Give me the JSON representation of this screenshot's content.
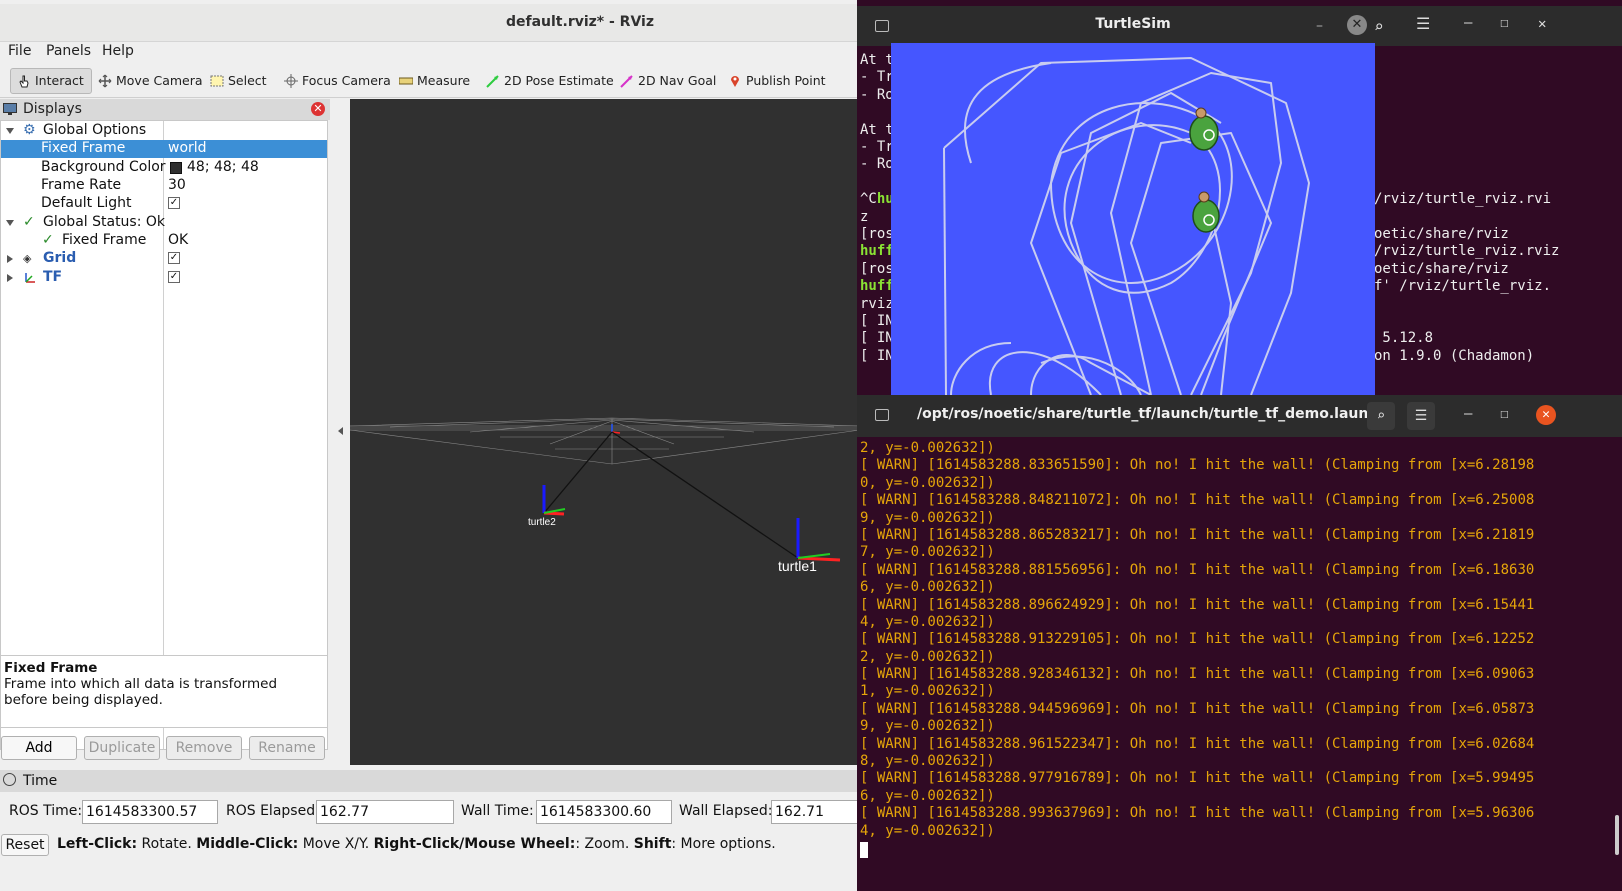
{
  "rviz": {
    "title": "default.rviz* - RViz",
    "menu": [
      "File",
      "Panels",
      "Help"
    ],
    "toolbar": [
      "Interact",
      "Move Camera",
      "Select",
      "Focus Camera",
      "Measure",
      "2D Pose Estimate",
      "2D Nav Goal",
      "Publish Point"
    ],
    "displays": {
      "header": "Displays",
      "global_options": "Global Options",
      "fixed_frame_label": "Fixed Frame",
      "fixed_frame_value": "world",
      "background_color_label": "Background Color",
      "background_color_value": "48; 48; 48",
      "background_color_swatch": "#303030",
      "frame_rate_label": "Frame Rate",
      "frame_rate_value": "30",
      "default_light_label": "Default Light",
      "global_status": "Global Status: Ok",
      "status_fixed_frame_label": "Fixed Frame",
      "status_fixed_frame_value": "OK",
      "grid": "Grid",
      "tf": "TF"
    },
    "description": {
      "title": "Fixed Frame",
      "text": "Frame into which all data is transformed before being displayed."
    },
    "buttons": {
      "add": "Add",
      "duplicate": "Duplicate",
      "remove": "Remove",
      "rename": "Rename"
    },
    "view": {
      "turtle2_label": "turtle2",
      "turtle1_label": "turtle1"
    },
    "time": {
      "header": "Time",
      "ros_time_label": "ROS Time:",
      "ros_time": "1614583300.57",
      "ros_elapsed_label": "ROS Elapsed:",
      "ros_elapsed": "162.77",
      "wall_time_label": "Wall Time:",
      "wall_time": "1614583300.60",
      "wall_elapsed_label": "Wall Elapsed:",
      "wall_elapsed": "162.71",
      "reset": "Reset",
      "hint_left": "Left-Click:",
      "hint_left_text": " Rotate. ",
      "hint_middle": "Middle-Click:",
      "hint_middle_text": " Move X/Y. ",
      "hint_right": "Right-Click/Mouse Wheel:",
      "hint_right_text": ": Zoom. ",
      "hint_shift": "Shift",
      "hint_shift_text": ": More options."
    }
  },
  "turtlesim": {
    "title": "TurtleSim",
    "bg_color": "#4556ff"
  },
  "terminal_back": {
    "lines": [
      {
        "a": "At t",
        "b": ""
      },
      {
        "a": "- Tr",
        "b": ""
      },
      {
        "a": "- Ro",
        "b": ""
      },
      {
        "a": "",
        "b": ""
      },
      {
        "a": "At t",
        "b": ""
      },
      {
        "a": "- Tr",
        "b": ""
      },
      {
        "a": "- Ro",
        "b": ""
      },
      {
        "a": "",
        "b": ""
      },
      {
        "a": "^Chu",
        "b": "/rviz/turtle_rviz.rvi"
      },
      {
        "a": "z",
        "b": ""
      },
      {
        "a": "[ros",
        "b": "oetic/share/rviz"
      },
      {
        "a": "huff",
        "b": "/rviz/turtle_rviz.rviz"
      },
      {
        "a": "[ros",
        "b": "oetic/share/rviz"
      },
      {
        "a": "huff",
        "b": "f' /rviz/turtle_rviz."
      },
      {
        "a": "rviz",
        "b": ""
      },
      {
        "a": "[ IN",
        "b": ""
      },
      {
        "a": "[ IN",
        "b": " 5.12.8"
      },
      {
        "a": "[ IN",
        "b": "on 1.9.0 (Chadamon)"
      }
    ]
  },
  "terminal_front": {
    "title": "/opt/ros/noetic/share/turtle_tf/launch/turtle_tf_demo.laun...",
    "lines": [
      "2, y=-0.002632])",
      "[ WARN] [1614583288.833651590]: Oh no! I hit the wall! (Clamping from [x=6.28198",
      "0, y=-0.002632])",
      "[ WARN] [1614583288.848211072]: Oh no! I hit the wall! (Clamping from [x=6.25008",
      "9, y=-0.002632])",
      "[ WARN] [1614583288.865283217]: Oh no! I hit the wall! (Clamping from [x=6.21819",
      "7, y=-0.002632])",
      "[ WARN] [1614583288.881556956]: Oh no! I hit the wall! (Clamping from [x=6.18630",
      "6, y=-0.002632])",
      "[ WARN] [1614583288.896624929]: Oh no! I hit the wall! (Clamping from [x=6.15441",
      "4, y=-0.002632])",
      "[ WARN] [1614583288.913229105]: Oh no! I hit the wall! (Clamping from [x=6.12252",
      "2, y=-0.002632])",
      "[ WARN] [1614583288.928346132]: Oh no! I hit the wall! (Clamping from [x=6.09063",
      "1, y=-0.002632])",
      "[ WARN] [1614583288.944596969]: Oh no! I hit the wall! (Clamping from [x=6.05873",
      "9, y=-0.002632])",
      "[ WARN] [1614583288.961522347]: Oh no! I hit the wall! (Clamping from [x=6.02684",
      "8, y=-0.002632])",
      "[ WARN] [1614583288.977916789]: Oh no! I hit the wall! (Clamping from [x=5.99495",
      "6, y=-0.002632])",
      "[ WARN] [1614583288.993637969]: Oh no! I hit the wall! (Clamping from [x=5.96306",
      "4, y=-0.002632])"
    ]
  }
}
